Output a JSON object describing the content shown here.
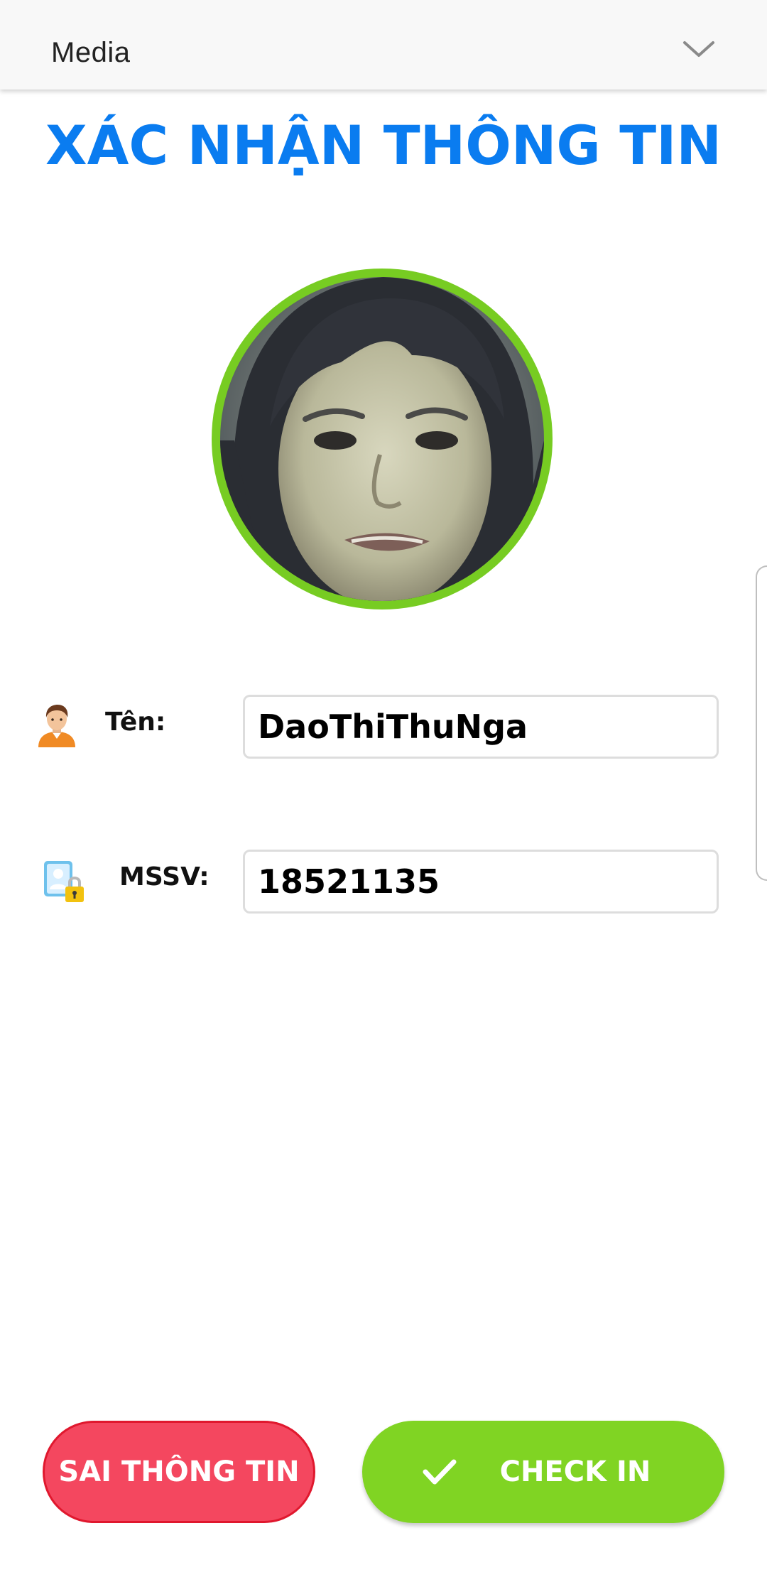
{
  "media_bar": {
    "label": "Media",
    "icon": "chevron-down-icon"
  },
  "title": "XÁC NHẬN THÔNG TIN",
  "avatar": {
    "ring_color": "#77cc22"
  },
  "fields": {
    "name": {
      "label": "Tên:",
      "value": "DaoThiThuNga",
      "icon": "person-icon"
    },
    "student_id": {
      "label": "MSSV:",
      "value": "18521135",
      "icon": "contact-lock-icon"
    }
  },
  "buttons": {
    "wrong_info": {
      "label": "SAI THÔNG TIN",
      "color": "#f4475f"
    },
    "check_in": {
      "label": "CHECK IN",
      "icon": "checkmark-icon",
      "color": "#80d423"
    }
  },
  "colors": {
    "title": "#0a7cf0"
  }
}
